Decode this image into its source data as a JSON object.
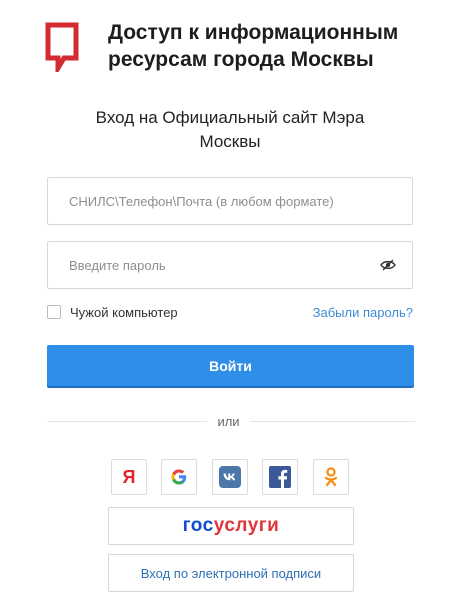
{
  "header": {
    "brand_title_line1": "Доступ к информационным",
    "brand_title_line2": "ресурсам города Москвы",
    "logo_icon": "speech-bubble-logo-icon",
    "brand_color": "#d32b2f"
  },
  "subtitle_line1": "Вход на Официальный сайт Мэра",
  "subtitle_line2": "Москвы",
  "form": {
    "login_placeholder": "СНИЛС\\Телефон\\Почта (в любом формате)",
    "login_value": "",
    "password_placeholder": "Введите пароль",
    "password_value": "",
    "show_password_icon": "eye-icon",
    "remember_label": "Чужой компьютер",
    "remember_checked": false,
    "forgot_link": "Забыли пароль?",
    "submit_label": "Войти",
    "accent_color": "#2f8fe8"
  },
  "divider_label": "или",
  "social": {
    "yandex_glyph": "Я",
    "yandex_icon": "yandex-icon",
    "google_icon": "google-icon",
    "vk_icon": "vk-icon",
    "facebook_icon": "facebook-icon",
    "odnoklassniki_icon": "odnoklassniki-icon"
  },
  "gosuslugi": {
    "part1": "гос",
    "part2": "услуги"
  },
  "esign_label": "Вход по электронной подписи"
}
